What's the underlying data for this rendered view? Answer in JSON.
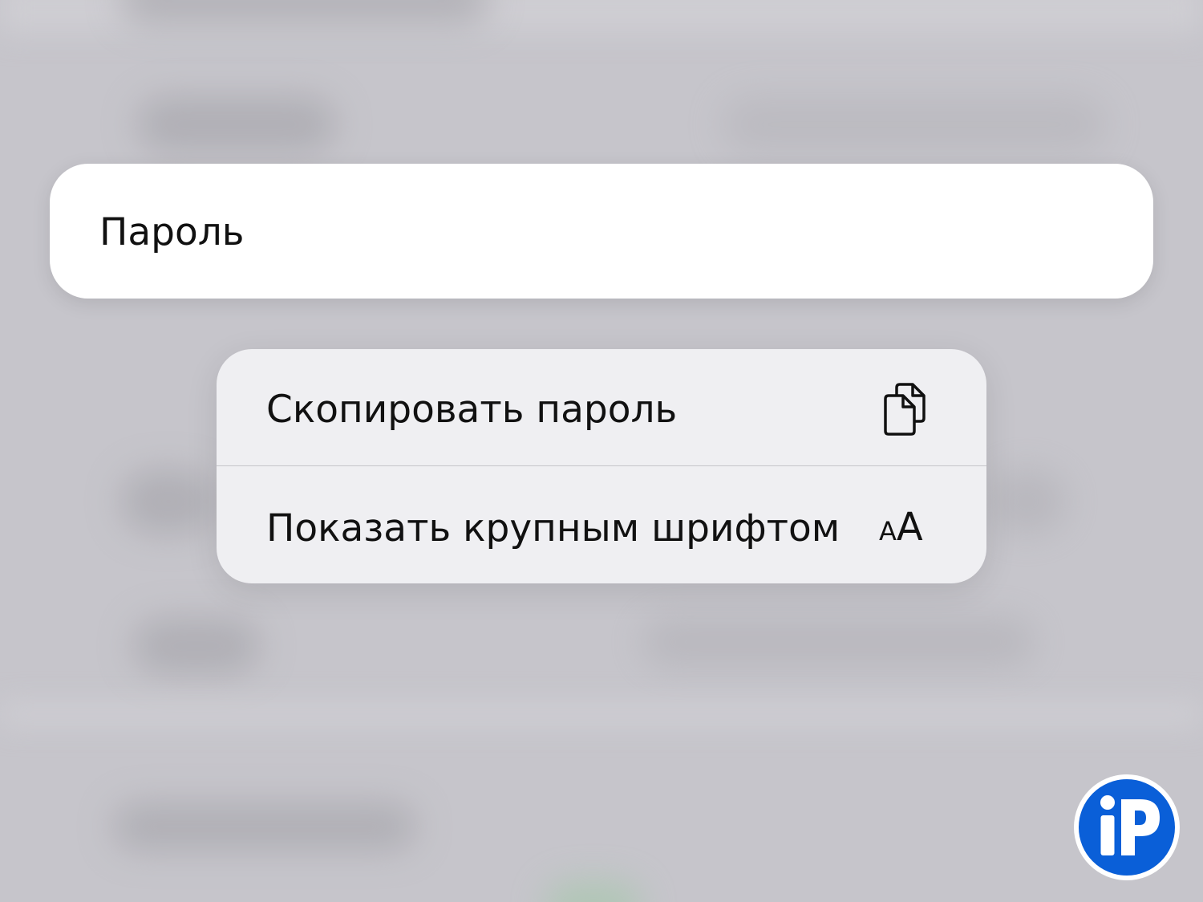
{
  "password_row": {
    "label": "Пароль"
  },
  "context_menu": {
    "items": [
      {
        "label": "Скопировать пароль",
        "icon": "copy-icon"
      },
      {
        "label": "Показать крупным шрифтом",
        "icon": "text-size-icon",
        "icon_text_small": "A",
        "icon_text_large": "A"
      }
    ]
  },
  "watermark": {
    "text": "iP",
    "color": "#0a5fd8"
  },
  "colors": {
    "background": "#c6c5cb",
    "cell_background": "#ffffff",
    "menu_background": "#efeff2",
    "text": "#111111"
  }
}
